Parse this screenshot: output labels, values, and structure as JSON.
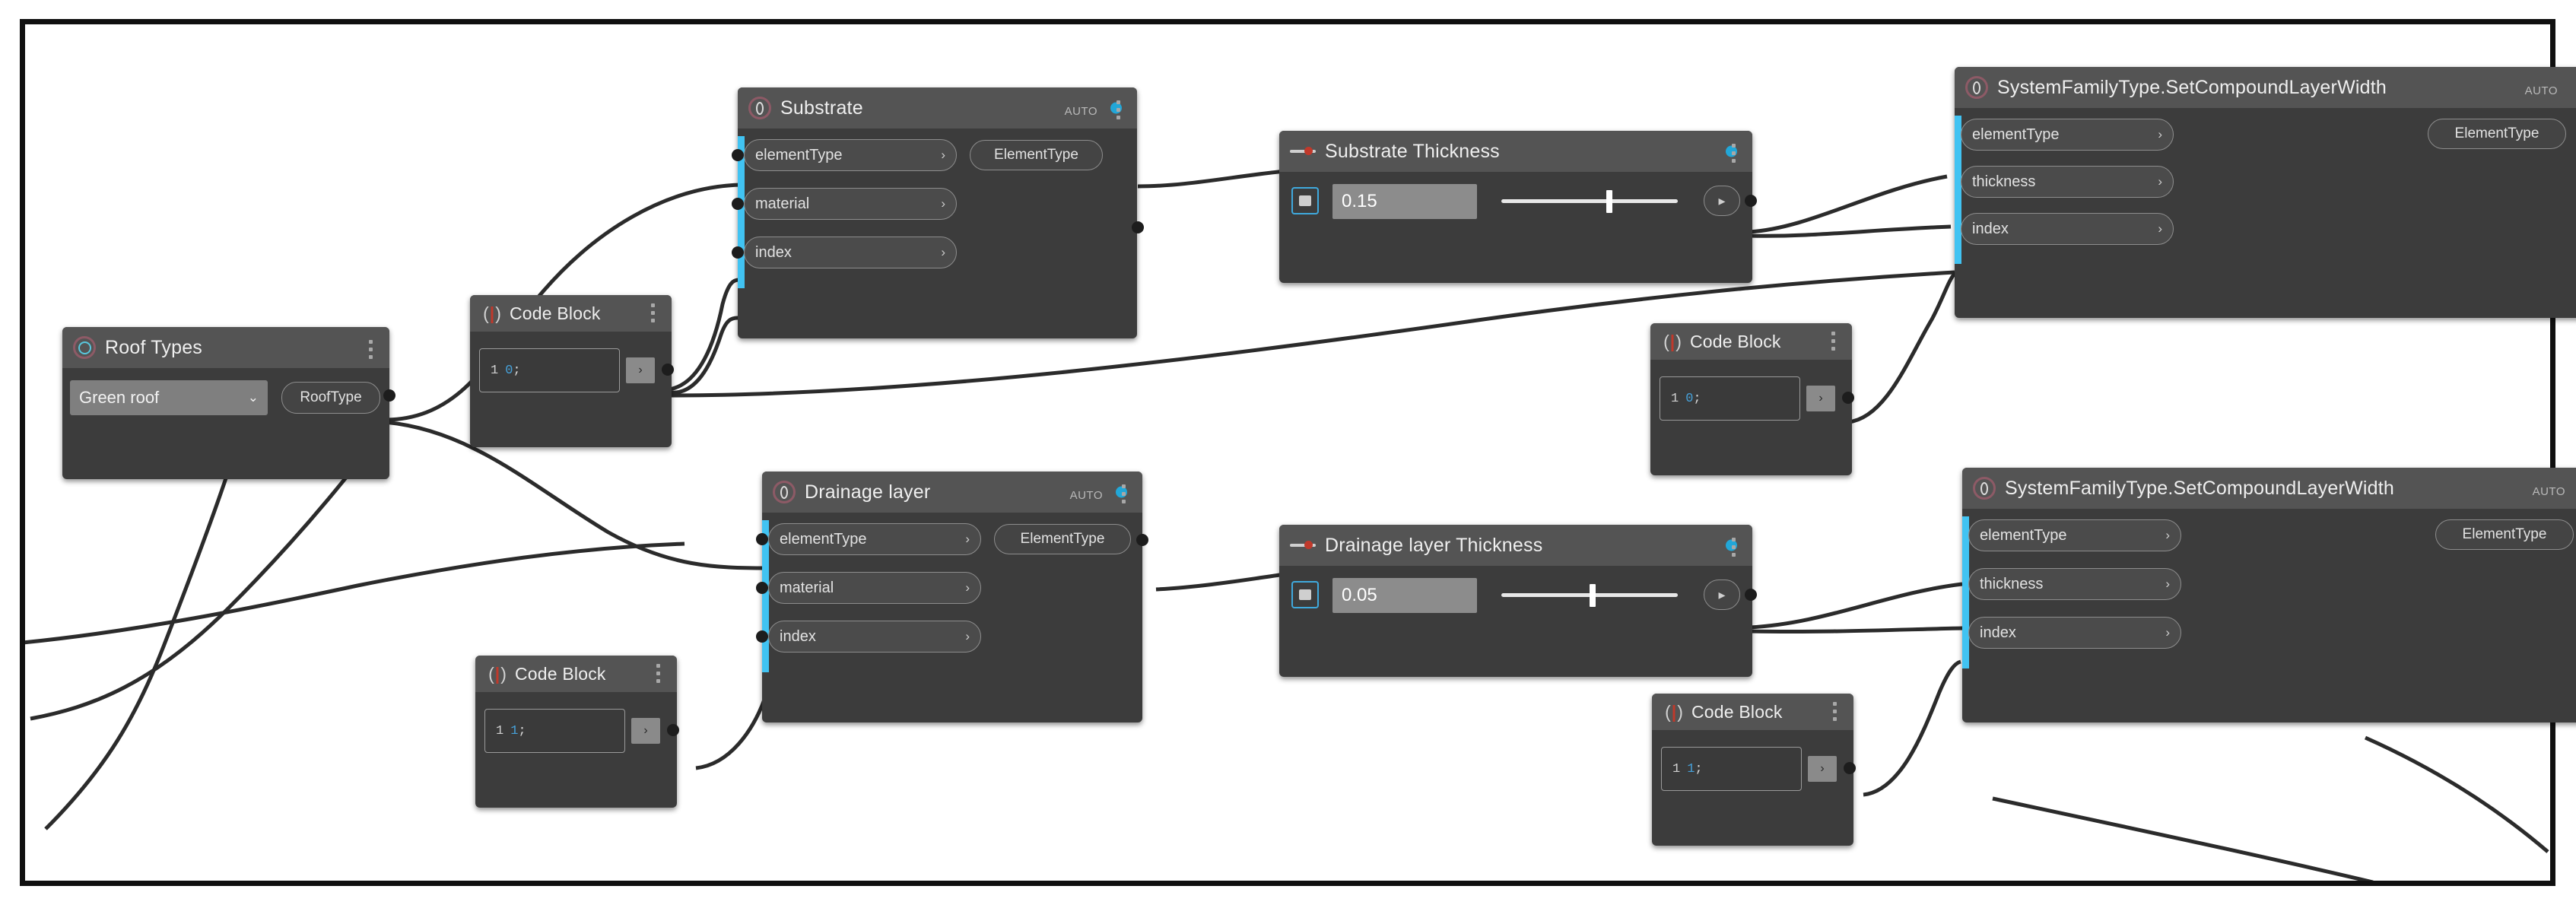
{
  "app": {
    "name": "Dynamo Graph Canvas",
    "background": "#ffffff",
    "node_bg": "#3c3c3c",
    "node_header_bg": "#545454",
    "accent_blue": "#22a7d8",
    "port_rail_blue": "#41c3f2",
    "border_color": "#101010"
  },
  "icons": {
    "revit_node": "revit-node-icon",
    "dropdown_node": "dropdown-node-icon",
    "code_block": "code-block-icon",
    "slider": "number-slider-icon",
    "chevron_right": "›",
    "chevron_down": "⌄",
    "caret_right": "▸"
  },
  "labels": {
    "auto": "AUTO",
    "element_type_out": "ElementType",
    "element_type_in": "elementType",
    "material_in": "material",
    "index_in": "index",
    "thickness_in": "thickness",
    "code_block_title": "Code Block"
  },
  "nodes": [
    {
      "id": "roof-types",
      "type": "dropdown",
      "title": "Roof Types",
      "selected_value": "Green roof",
      "output": "RoofType",
      "status_dot": false
    },
    {
      "id": "substrate",
      "type": "revit",
      "title": "Substrate",
      "status_dot": true,
      "inputs": [
        "elementType",
        "material",
        "index"
      ],
      "outputs": [
        "ElementType"
      ],
      "auto": "AUTO"
    },
    {
      "id": "substrate-thickness",
      "type": "slider",
      "title": "Substrate Thickness",
      "status_dot": true,
      "value": "0.15",
      "slider_fraction": 0.62
    },
    {
      "id": "sfts-top",
      "type": "revit",
      "title": "SystemFamilyType.SetCompoundLayerWidth",
      "status_dot": false,
      "inputs": [
        "elementType",
        "thickness",
        "index"
      ],
      "outputs": [
        "ElementType"
      ],
      "auto": "AUTO"
    },
    {
      "id": "drainage-layer",
      "type": "revit",
      "title": "Drainage layer",
      "status_dot": true,
      "inputs": [
        "elementType",
        "material",
        "index"
      ],
      "outputs": [
        "ElementType"
      ],
      "auto": "AUTO"
    },
    {
      "id": "drainage-thickness",
      "type": "slider",
      "title": "Drainage layer Thickness",
      "status_dot": true,
      "value": "0.05",
      "slider_fraction": 0.52
    },
    {
      "id": "sfts-bottom",
      "type": "revit",
      "title": "SystemFamilyType.SetCompoundLayerWidth",
      "status_dot": false,
      "inputs": [
        "elementType",
        "thickness",
        "index"
      ],
      "outputs": [
        "ElementType"
      ],
      "auto": "AUTO"
    },
    {
      "id": "cb-top-left",
      "type": "codeblock",
      "title": "Code Block",
      "line_number": "1",
      "code_value": "0",
      "code_terminator": ";"
    },
    {
      "id": "cb-top-right",
      "type": "codeblock",
      "title": "Code Block",
      "line_number": "1",
      "code_value": "0",
      "code_terminator": ";"
    },
    {
      "id": "cb-bottom-left",
      "type": "codeblock",
      "title": "Code Block",
      "line_number": "1",
      "code_value": "1",
      "code_terminator": ";"
    },
    {
      "id": "cb-bottom-right",
      "type": "codeblock",
      "title": "Code Block",
      "line_number": "1",
      "code_value": "1",
      "code_terminator": ";"
    }
  ]
}
